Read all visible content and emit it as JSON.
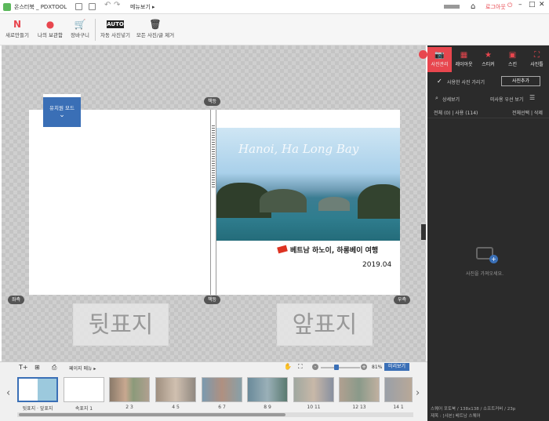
{
  "titlebar": {
    "app_title": "온스터북 _ PDXTOOL",
    "menu_label": "메뉴보기 ▸",
    "logout_label": "로그아웃"
  },
  "toolbar": {
    "new_label": "새로만들기",
    "storage_label": "나의 보관함",
    "cart_label": "장바구니",
    "auto_label": "자동 사진넣기",
    "auto_glyph": "AUTO",
    "delete_all_label": "모든 사진/글 제거"
  },
  "canvas": {
    "guide_mode": "유치원 모드",
    "spine_label": "책등",
    "wing_label": "책등",
    "left_label": "좌측",
    "right_label": "우측",
    "back_cover_label": "뒷표지",
    "front_cover_label": "앞표지",
    "cover_title": "Hanoi, Ha Long Bay",
    "cover_subtitle": "베트남 하노이, 하롱베이 여행",
    "cover_date": "2019.04"
  },
  "strip": {
    "page_menu": "페이지 메뉴 ▸",
    "zoom": "81%",
    "preview": "미리보기",
    "thumbs": [
      {
        "label": "뒷표지 · 앞표지"
      },
      {
        "label": "속표지 1"
      },
      {
        "label": "2 3"
      },
      {
        "label": "4 5"
      },
      {
        "label": "6 7"
      },
      {
        "label": "8 9"
      },
      {
        "label": "10 11"
      },
      {
        "label": "12 13"
      },
      {
        "label": "14 1"
      }
    ]
  },
  "rpanel": {
    "tabs": [
      {
        "label": "사진관리",
        "icon": "camera-icon"
      },
      {
        "label": "레이아웃",
        "icon": "layout-icon"
      },
      {
        "label": "스티커",
        "icon": "star-icon"
      },
      {
        "label": "스킨",
        "icon": "image-icon"
      },
      {
        "label": "사진틀",
        "icon": "frame-icon"
      }
    ],
    "hide_used_label": "사용한 사진 가리기",
    "add_photo_label": "사진추가",
    "detail_label": "상세보기",
    "unused_first_label": "미사용 우선 보기",
    "count_label": "전체 (0) | 사용 (114)",
    "select_delete_label": "전체선택 | 삭제",
    "empty_msg": "사진을 가져오세요.",
    "footer_line1": "스퀘어 포토북 / 138x138 / 소프트커버 / 23p",
    "footer_line2": "제목 : [샤본] 베트남 스퀘어"
  },
  "colors": {
    "accent": "#e8464e",
    "guide_blue": "#3a6fb6"
  }
}
